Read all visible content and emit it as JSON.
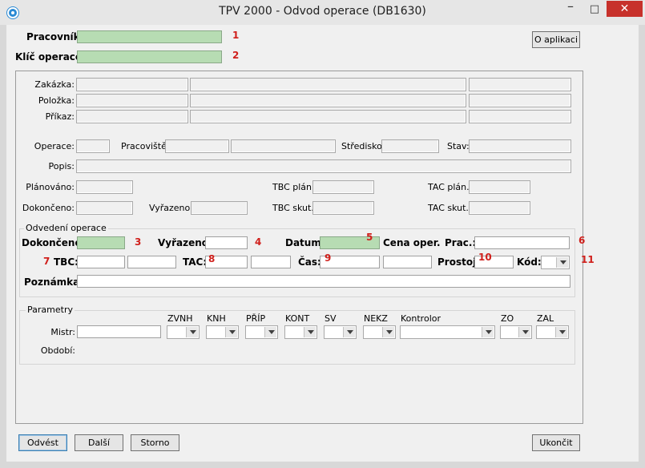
{
  "window": {
    "title": "TPV 2000 - Odvod operace (DB1630)",
    "minimize": "–",
    "maximize": "□",
    "close": "✕"
  },
  "header": {
    "pracovnik_label": "Pracovník:",
    "klic_label": "Klíč operace:",
    "about_button": "O aplikaci"
  },
  "info": {
    "zakazka_label": "Zakázka:",
    "polozka_label": "Položka:",
    "prikaz_label": "Příkaz:",
    "operace_label": "Operace:",
    "pracoviste_label": "Pracoviště:",
    "stredisko_label": "Středisko:",
    "stav_label": "Stav:",
    "popis_label": "Popis:",
    "planovano_label": "Plánováno:",
    "dokonceno_label": "Dokončeno:",
    "vyrazeno_label": "Vyřazeno:",
    "tbc_plan_label": "TBC plán.:",
    "tbc_skut_label": "TBC skut.:",
    "tac_plan_label": "TAC plán.:",
    "tac_skut_label": "TAC skut.:"
  },
  "odvedeni": {
    "legend": "Odvedení operace",
    "dokonceno_label": "Dokončeno:",
    "vyrazeno_label": "Vyřazeno:",
    "datum_label": "Datum:",
    "cena_label": "Cena oper.",
    "prac_label": "Prac.:",
    "tbc_label": "TBC:",
    "tac_label": "TAC:",
    "cas_label": "Čas:",
    "prostoj_label": "Prostoj:",
    "kod_label": "Kód:",
    "poznamka_label": "Poznámka:"
  },
  "parametry": {
    "legend": "Parametry",
    "mistr_label": "Mistr:",
    "obdobi_label": "Období:",
    "columns": [
      "ZVNH",
      "KNH",
      "PŘÍP",
      "KONT",
      "SV",
      "NEKZ",
      "Kontrolor",
      "ZO",
      "ZAL"
    ]
  },
  "markers": [
    "1",
    "2",
    "3",
    "4",
    "5",
    "6",
    "7",
    "8",
    "9",
    "10",
    "11"
  ],
  "footer": {
    "odvest": "Odvést",
    "dalsi": "Další",
    "storno": "Storno",
    "ukoncit": "Ukončit"
  },
  "colors": {
    "required_field": "#b7dcb3",
    "marker": "#d0201c",
    "close_button": "#c7312b"
  }
}
